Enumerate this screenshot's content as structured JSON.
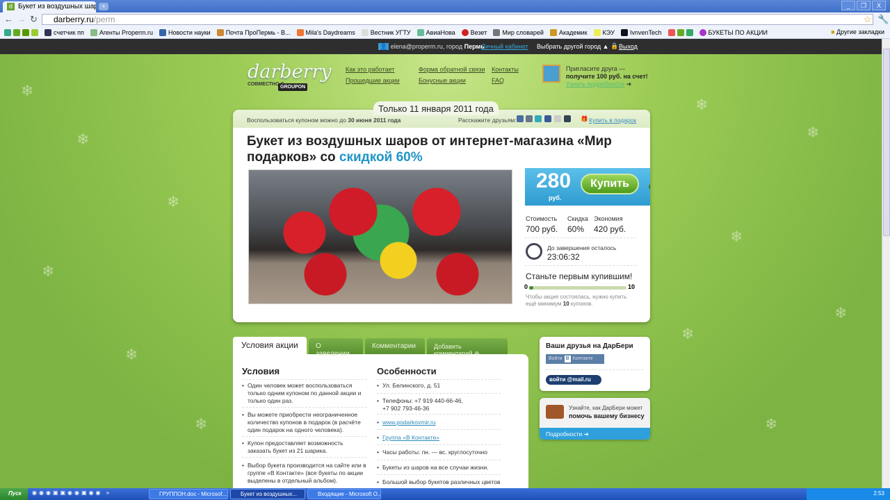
{
  "browser": {
    "tab_title": "Букет из воздушных шар...",
    "url_host": "darberry.ru",
    "url_path": "/perm",
    "new_tab": "+",
    "window_buttons": [
      "_",
      "❐",
      "X"
    ],
    "bookmarks": [
      "счетчик пп",
      "Агенты Properm.ru",
      "Новости науки",
      "Почта ПроПермь - В...",
      "Mila's Daydreams",
      "Вестник УГТУ",
      "АвиаНова",
      "Везет",
      "Мир словарей",
      "Академик",
      "КЭУ",
      "IvnvenTech",
      "БУКЕТЫ ПО АКЦИИ"
    ],
    "other_bookmarks": "Другие закладки"
  },
  "sitebar": {
    "email": "elena@properm.ru",
    "city_prefix": ", город",
    "city": "Пермь",
    "cabinet": "Личный кабинет",
    "choose_city": "Выбрать другой город ▲",
    "logout": "Выход"
  },
  "header": {
    "logo": "darberry",
    "logo_sub": "СОВМЕСТНО С",
    "groupon": "GROUPON",
    "links": [
      "Как это работает",
      "Прошедшие акции",
      "Форма обратной связи",
      "Бонусные акции",
      "Контакты",
      "FAQ"
    ],
    "invite_line1": "Пригласите друга —",
    "invite_line2": "получите 100 руб. на счет!",
    "invite_more": "Узнать подробности"
  },
  "deal": {
    "date_tab": "Только 11 января 2011 года",
    "until_prefix": "Воспользоваться купоном можно до ",
    "until_date": "30 июня 2011 года",
    "share_label": "Расскажите друзьям:",
    "gift": "Купить в подарок",
    "title": "Букет из воздушных шаров от интернет-магазина «Мир подарков» со ",
    "title_discount": "скидкой 60%",
    "price": "280",
    "currency": "руб.",
    "buy": "Купить",
    "cost_label": "Стоимость",
    "cost": "700 руб.",
    "discount_label": "Скидка",
    "discount": "60%",
    "saving_label": "Экономия",
    "saving": "420 руб.",
    "time_left_label": "До завершения осталось",
    "time_left": "23:06:32",
    "first_buyer": "Станьте первым купившим!",
    "progress_min": "0",
    "progress_max": "10",
    "progress_value": 0,
    "note_prefix": "Чтобы акция состоялась, нужно купить ещё минимум ",
    "note_count": "10",
    "note_suffix": " купонов."
  },
  "tabs": [
    "Условия акции",
    "О заведении",
    "Комментарии",
    "Добавить комментарий ⊕"
  ],
  "conditions": {
    "heading": "Условия",
    "items": [
      "Один человек может воспользоваться только одним купоном по данной акции и только один раз.",
      "Вы можете приобрести неограниченное количество купонов в подарок (в расчёте один подарок на одного человека).",
      "Купон предоставляет возможность заказать букет из 21 шарика.",
      "Выбор букета производится на сайте или в группе «В Контакте» (все букеты по акции выделены в отдельный альбом)."
    ]
  },
  "features": {
    "heading": "Особенности",
    "items": [
      "Ул. Белинского, д. 51",
      "Телефоны: +7 919 440-66-46, +7 902 793-46-36",
      "www.podarkovmir.ru",
      "Группа «В Контакте»",
      "Часы работы: пн. — вс. круглосуточно",
      "Букеты из шаров на все случаи жизни.",
      "Большой выбор букетов различных цветов"
    ]
  },
  "sidebar": {
    "friends_title": "Ваши друзья на ДарБери",
    "vk_login": "Войти",
    "vk_b": "B",
    "vk_name": "Контакте",
    "mailru": "войти @mail.ru",
    "biz_line1": "Узнайте, как ДарБери может",
    "biz_line2": "помочь вашему бизнесу",
    "biz_more": "Подробности ➔"
  },
  "taskbar": {
    "start": "Пуск",
    "windows": [
      "ГРУППОН.doc - Microsof...",
      "Букет из воздушных...",
      "Входящие - Microsoft O..."
    ],
    "clock": "2:53"
  },
  "colors": {
    "accent_blue": "#2e9bd0",
    "buy_green": "#4c9a1a",
    "background_green": "#7cb342"
  }
}
